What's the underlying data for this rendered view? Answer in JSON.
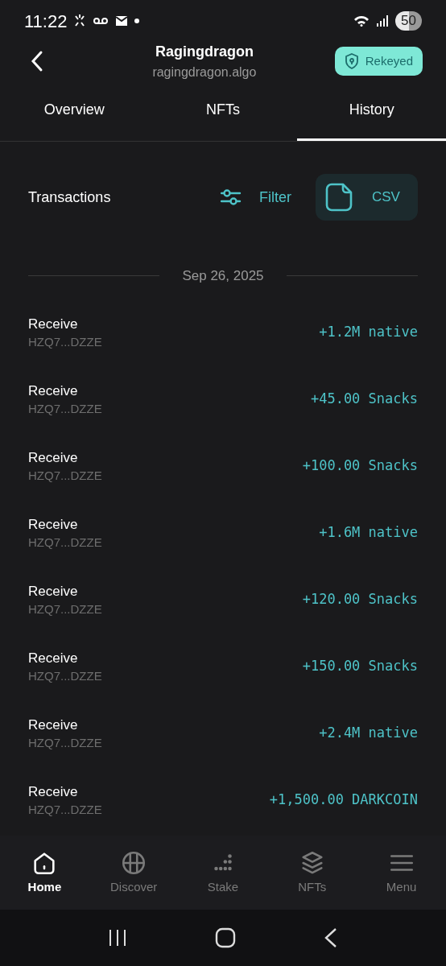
{
  "status_bar": {
    "time": "11:22",
    "battery": "50"
  },
  "header": {
    "title": "Ragingdragon",
    "subtitle": "ragingdragon.algo",
    "badge": "Rekeyed"
  },
  "tabs": [
    {
      "label": "Overview",
      "selected": false
    },
    {
      "label": "NFTs",
      "selected": false
    },
    {
      "label": "History",
      "selected": true
    }
  ],
  "toolbar": {
    "title": "Transactions",
    "filter": "Filter",
    "csv": "CSV"
  },
  "date": "Sep 26, 2025",
  "transactions": [
    {
      "type": "Receive",
      "address": "HZQ7...DZZE",
      "amount": "+1.2M native"
    },
    {
      "type": "Receive",
      "address": "HZQ7...DZZE",
      "amount": "+45.00 Snacks"
    },
    {
      "type": "Receive",
      "address": "HZQ7...DZZE",
      "amount": "+100.00 Snacks"
    },
    {
      "type": "Receive",
      "address": "HZQ7...DZZE",
      "amount": "+1.6M native"
    },
    {
      "type": "Receive",
      "address": "HZQ7...DZZE",
      "amount": "+120.00 Snacks"
    },
    {
      "type": "Receive",
      "address": "HZQ7...DZZE",
      "amount": "+150.00 Snacks"
    },
    {
      "type": "Receive",
      "address": "HZQ7...DZZE",
      "amount": "+2.4M native"
    },
    {
      "type": "Receive",
      "address": "HZQ7...DZZE",
      "amount": "+1,500.00 DARKCOIN"
    }
  ],
  "bottom_nav": [
    {
      "label": "Home",
      "selected": true
    },
    {
      "label": "Discover",
      "selected": false
    },
    {
      "label": "Stake",
      "selected": false
    },
    {
      "label": "NFTs",
      "selected": false
    },
    {
      "label": "Menu",
      "selected": false
    }
  ]
}
